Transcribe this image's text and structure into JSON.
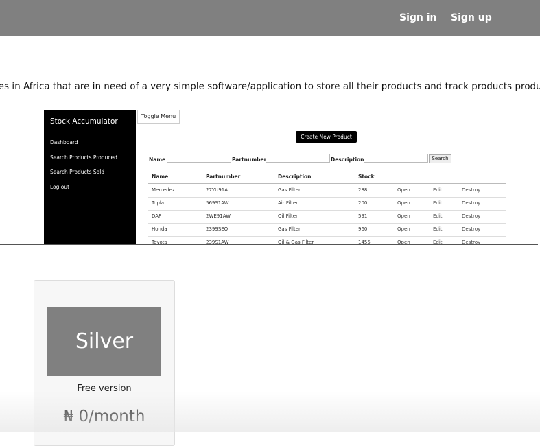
{
  "nav": {
    "sign_in": "Sign in",
    "sign_up": "Sign up",
    "bg_color": "#808080"
  },
  "intro": {
    "text": "ies in Africa that are in need of a very simple software/application to store all their products and track products produced"
  },
  "screenshot": {
    "brand": "Stock Accumulator",
    "toggle_menu": "Toggle Menu",
    "menu": [
      "Dashboard",
      "Search Products Produced",
      "Search Products Sold",
      "Log out"
    ],
    "create_button": "Create New Product",
    "search_labels": {
      "name": "Name",
      "partnumber": "Partnumber",
      "description": "Description"
    },
    "search_button": "Search",
    "columns": [
      "Name",
      "Partnumber",
      "Description",
      "Stock"
    ],
    "rows": [
      {
        "name": "Mercedez",
        "partnumber": "27YU91A",
        "description": "Gas Filter",
        "stock": "288",
        "open": "Open",
        "edit": "Edit",
        "destroy": "Destroy"
      },
      {
        "name": "Topla",
        "partnumber": "569S1AW",
        "description": "Air Filter",
        "stock": "200",
        "open": "Open",
        "edit": "Edit",
        "destroy": "Destroy"
      },
      {
        "name": "DAF",
        "partnumber": "2WE91AW",
        "description": "Oil Filter",
        "stock": "591",
        "open": "Open",
        "edit": "Edit",
        "destroy": "Destroy"
      },
      {
        "name": "Honda",
        "partnumber": "2399SEO",
        "description": "Gas Filter",
        "stock": "960",
        "open": "Open",
        "edit": "Edit",
        "destroy": "Destroy"
      },
      {
        "name": "Toyota",
        "partnumber": "239S1AW",
        "description": "Oil & Gas Filter",
        "stock": "1455",
        "open": "Open",
        "edit": "Edit",
        "destroy": "Destroy"
      }
    ]
  },
  "pricing": {
    "tier": "Silver",
    "version": "Free version",
    "price": "₦ 0/month",
    "tier_color": "#808080"
  }
}
